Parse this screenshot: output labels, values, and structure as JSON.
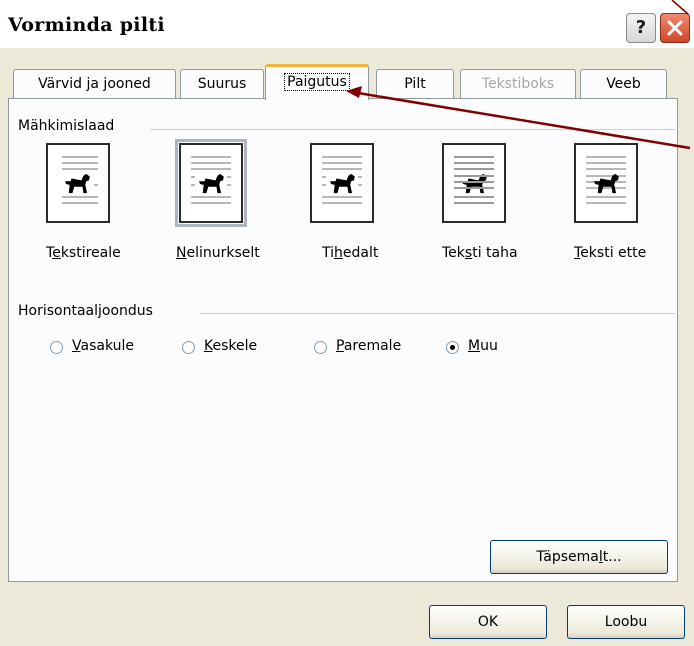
{
  "window": {
    "title": "Vorminda pilti",
    "help_label": "?"
  },
  "tabs": [
    {
      "label": "Värvid ja jooned",
      "state": "normal"
    },
    {
      "label": "Suurus",
      "state": "normal"
    },
    {
      "label": "Paigutus",
      "state": "active"
    },
    {
      "label": "Pilt",
      "state": "normal"
    },
    {
      "label": "Tekstiboks",
      "state": "disabled"
    },
    {
      "label": "Veeb",
      "state": "normal"
    }
  ],
  "wrapping": {
    "group_label": "Mähkimislaad",
    "selected": "Nelinurkselt",
    "items": [
      {
        "pre": "T",
        "key": "e",
        "post": "kstireale",
        "icon": "in-line-with-text-icon"
      },
      {
        "pre": "",
        "key": "N",
        "post": "elinurkselt",
        "icon": "square-wrap-icon"
      },
      {
        "pre": "Ti",
        "key": "h",
        "post": "edalt",
        "icon": "tight-wrap-icon"
      },
      {
        "pre": "Tek",
        "key": "s",
        "post": "ti taha",
        "icon": "behind-text-icon"
      },
      {
        "pre": "",
        "key": "T",
        "post": "eksti ette",
        "icon": "in-front-of-text-icon"
      }
    ]
  },
  "alignment": {
    "group_label": "Horisontaaljoondus",
    "selected": "Muu",
    "options": [
      {
        "pre": "",
        "key": "V",
        "post": "asakule"
      },
      {
        "pre": "",
        "key": "K",
        "post": "eskele"
      },
      {
        "pre": "",
        "key": "P",
        "post": "aremale"
      },
      {
        "pre": "",
        "key": "M",
        "post": "uu"
      }
    ]
  },
  "buttons": {
    "advanced": {
      "pre": "Täpsema",
      "key": "l",
      "post": "t..."
    },
    "ok": "OK",
    "cancel": "Loobu"
  },
  "colors": {
    "arrow": "#800000",
    "active_tab_accent": "#f2b33d"
  }
}
